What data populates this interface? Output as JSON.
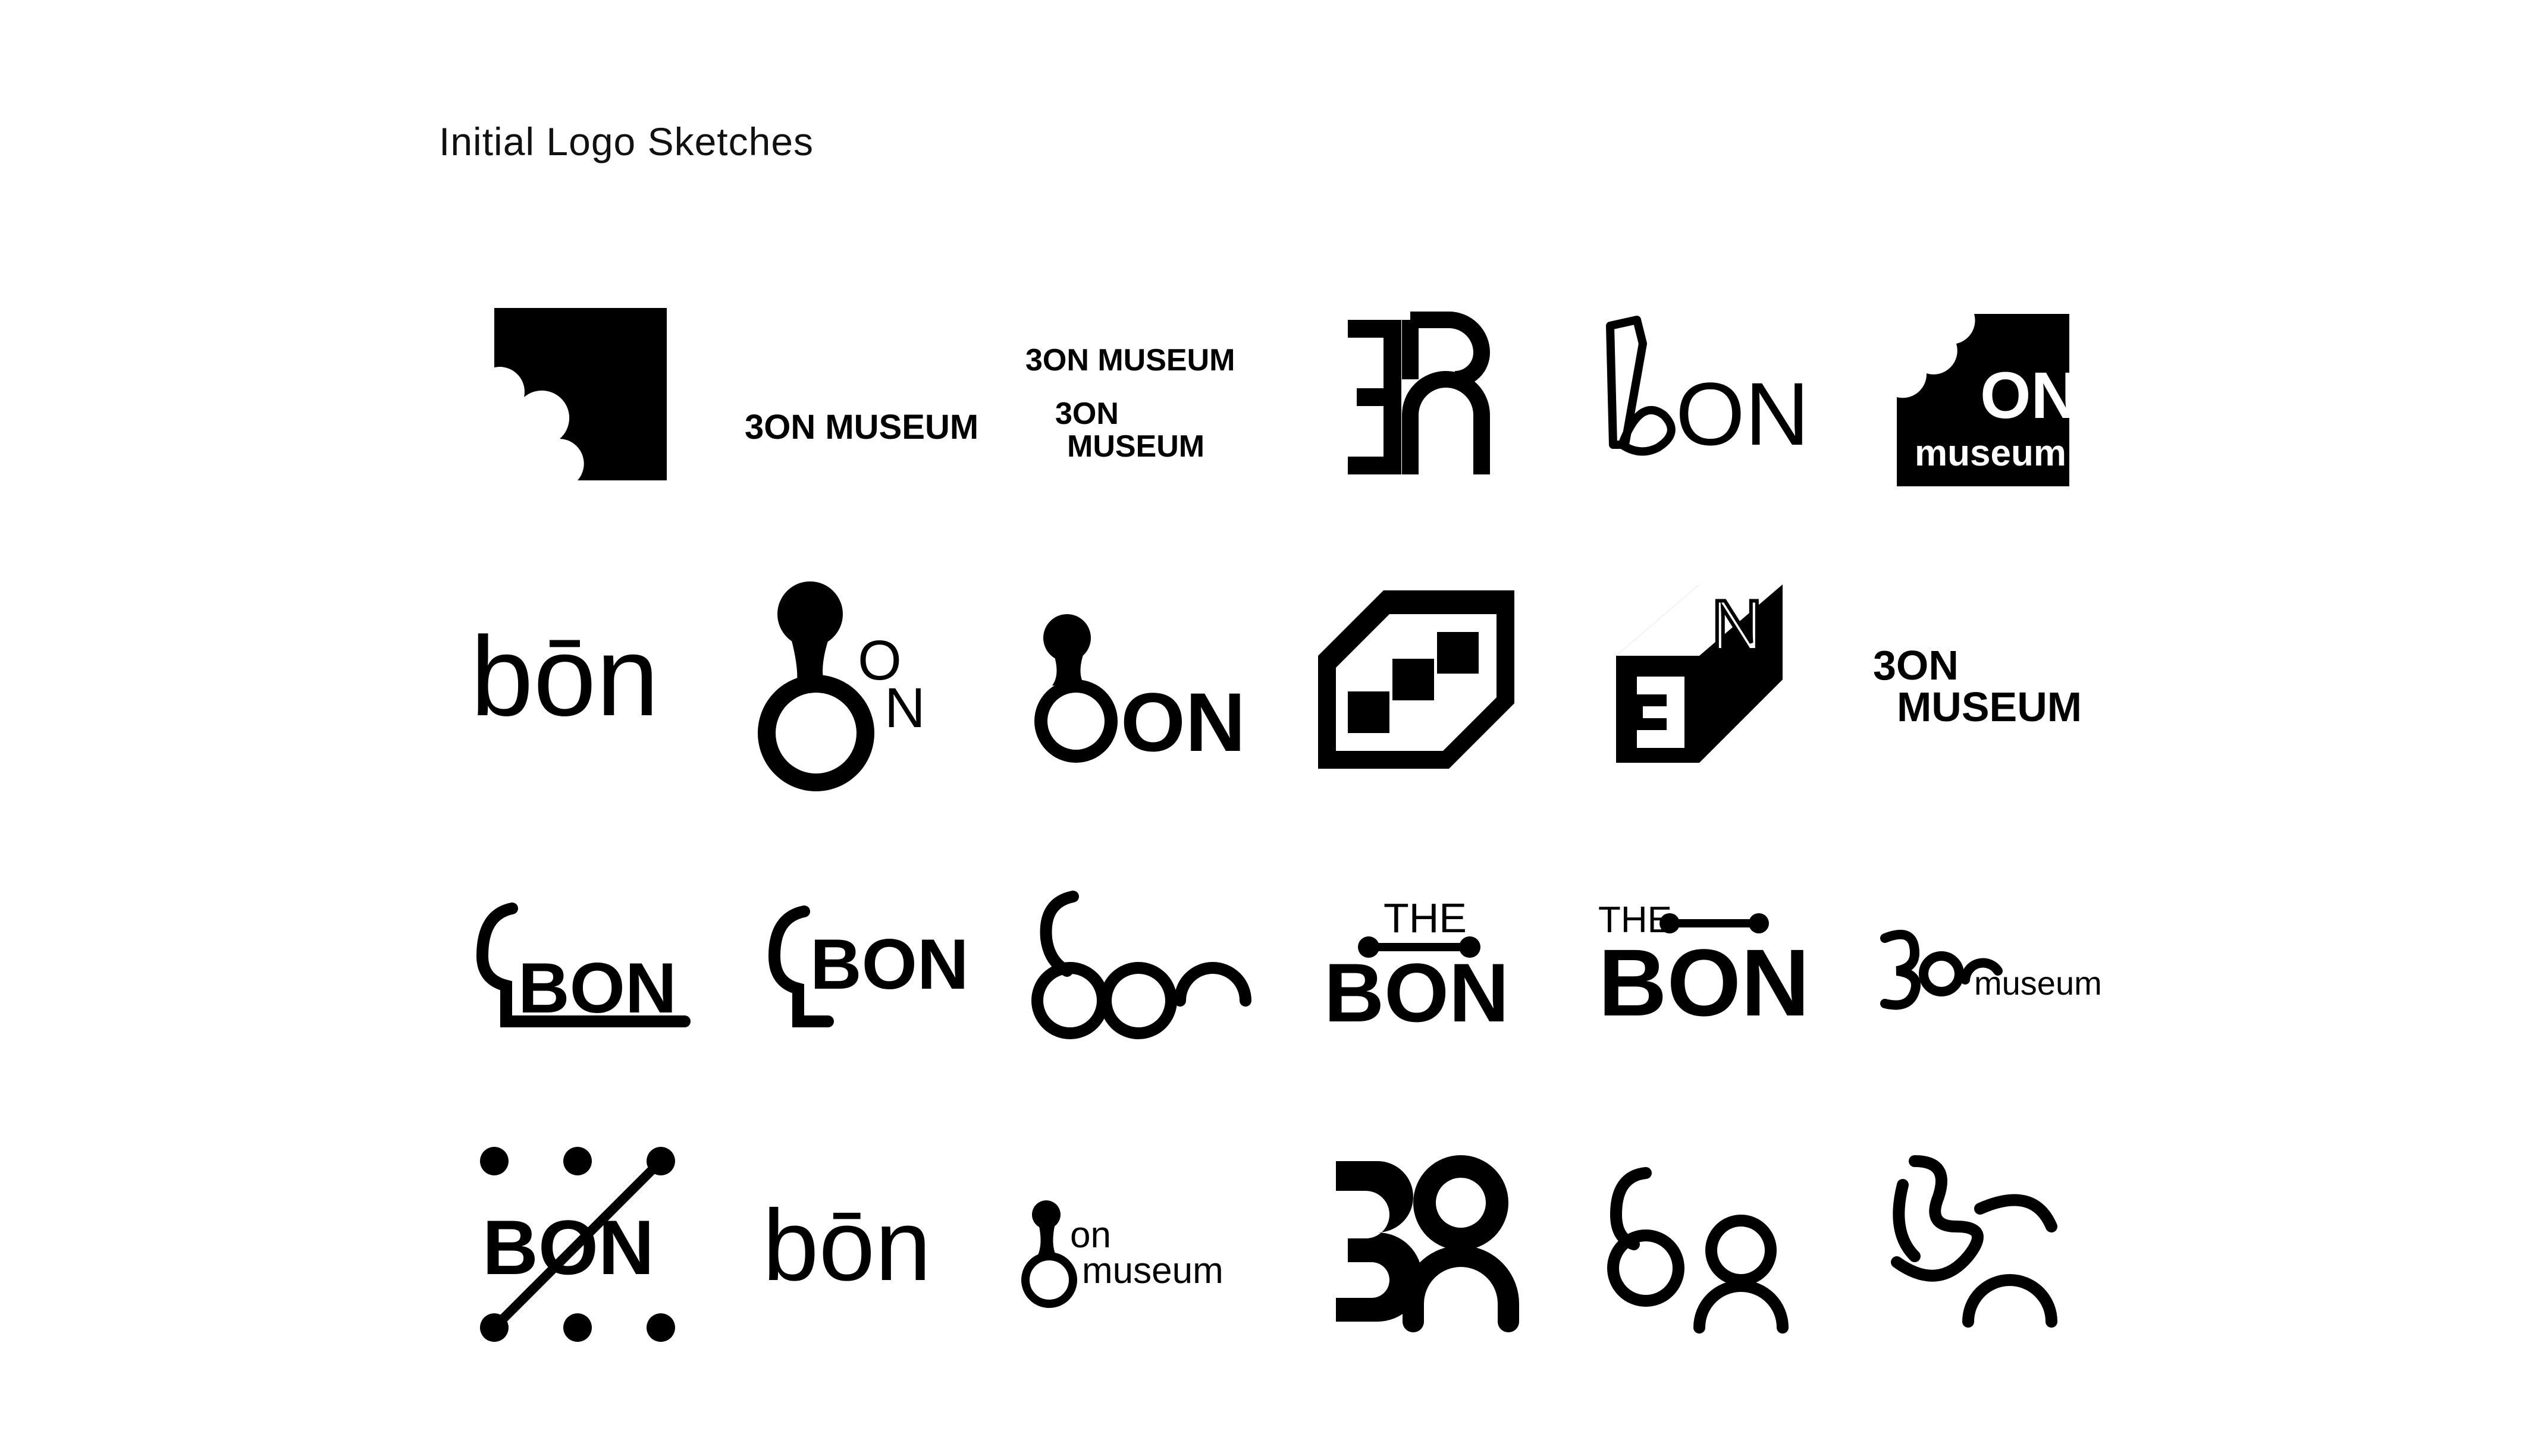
{
  "title": "Initial Logo Sketches",
  "ink_color": "#000000",
  "background_color": "#ffffff",
  "logos": [
    {
      "id": 1,
      "text_lines": []
    },
    {
      "id": 2,
      "text_lines": [
        "3ON MUSEUM",
        "3ON MUSEUM"
      ]
    },
    {
      "id": 3,
      "text_lines": [
        "3ON MUSEUM",
        "3ON",
        "MUSEUM"
      ]
    },
    {
      "id": 4,
      "text_lines": []
    },
    {
      "id": 5,
      "text_lines": [
        "ON"
      ]
    },
    {
      "id": 6,
      "text_lines": [
        "ON",
        "museum"
      ]
    },
    {
      "id": 7,
      "text_lines": [
        "bōn"
      ]
    },
    {
      "id": 8,
      "text_lines": [
        "O",
        "N"
      ]
    },
    {
      "id": 9,
      "text_lines": [
        "ON"
      ]
    },
    {
      "id": 10,
      "text_lines": []
    },
    {
      "id": 11,
      "text_lines": [
        "N"
      ]
    },
    {
      "id": 12,
      "text_lines": [
        "3ON",
        "MUSEUM"
      ]
    },
    {
      "id": 13,
      "text_lines": [
        "BON"
      ]
    },
    {
      "id": 14,
      "text_lines": [
        "BON"
      ]
    },
    {
      "id": 15,
      "text_lines": []
    },
    {
      "id": 16,
      "text_lines": [
        "THE",
        "BON"
      ]
    },
    {
      "id": 17,
      "text_lines": [
        "THE",
        "BON"
      ]
    },
    {
      "id": 18,
      "text_lines": [
        "museum"
      ]
    },
    {
      "id": 19,
      "text_lines": [
        "BON"
      ]
    },
    {
      "id": 20,
      "text_lines": [
        "bōn"
      ]
    },
    {
      "id": 21,
      "text_lines": [
        "on",
        "museum"
      ]
    },
    {
      "id": 22,
      "text_lines": []
    },
    {
      "id": 23,
      "text_lines": []
    },
    {
      "id": 24,
      "text_lines": []
    }
  ]
}
